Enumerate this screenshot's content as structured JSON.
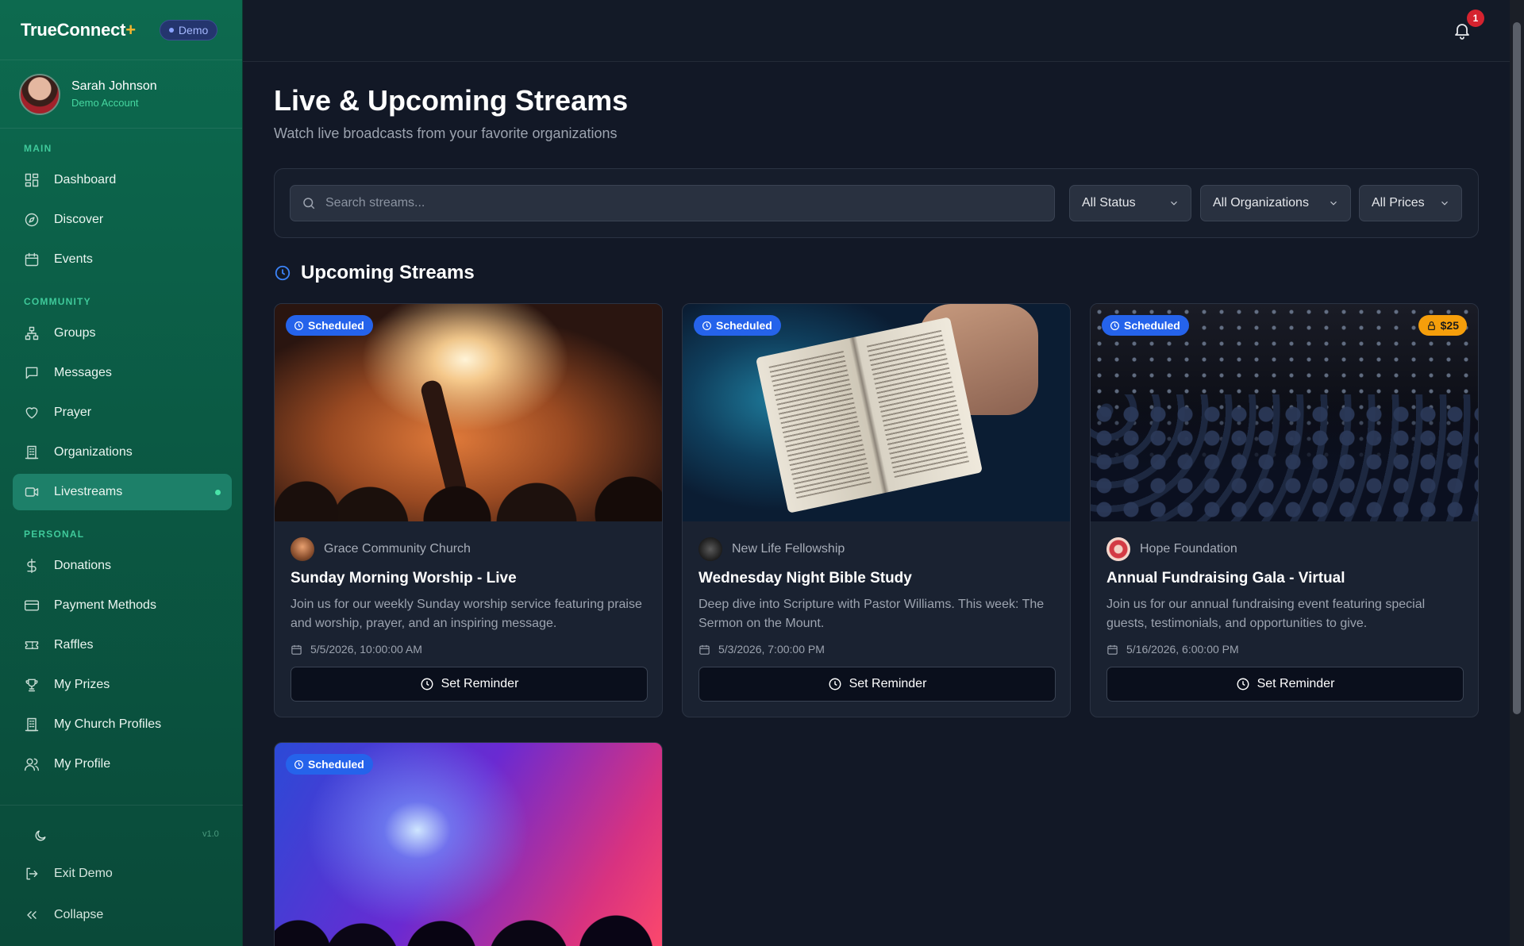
{
  "app": {
    "name": "TrueConnect",
    "plus": "+",
    "mode_badge": "Demo",
    "version": "v1.0"
  },
  "user": {
    "name": "Sarah Johnson",
    "subtitle": "Demo Account"
  },
  "sidebar": {
    "sections": [
      {
        "label": "MAIN",
        "items": [
          {
            "label": "Dashboard",
            "icon": "dashboard-icon"
          },
          {
            "label": "Discover",
            "icon": "compass-icon"
          },
          {
            "label": "Events",
            "icon": "calendar-icon"
          }
        ]
      },
      {
        "label": "COMMUNITY",
        "items": [
          {
            "label": "Groups",
            "icon": "network-icon"
          },
          {
            "label": "Messages",
            "icon": "message-icon"
          },
          {
            "label": "Prayer",
            "icon": "heart-icon"
          },
          {
            "label": "Organizations",
            "icon": "building-icon"
          },
          {
            "label": "Livestreams",
            "icon": "video-icon",
            "active": true
          }
        ]
      },
      {
        "label": "PERSONAL",
        "items": [
          {
            "label": "Donations",
            "icon": "dollar-icon"
          },
          {
            "label": "Payment Methods",
            "icon": "credit-card-icon"
          },
          {
            "label": "Raffles",
            "icon": "ticket-icon"
          },
          {
            "label": "My Prizes",
            "icon": "trophy-icon"
          },
          {
            "label": "My Church Profiles",
            "icon": "building-icon"
          },
          {
            "label": "My Profile",
            "icon": "users-icon"
          }
        ]
      }
    ],
    "footer": {
      "exit_label": "Exit Demo",
      "collapse_label": "Collapse"
    }
  },
  "topbar": {
    "notification_count": "1"
  },
  "page": {
    "title": "Live & Upcoming Streams",
    "subtitle": "Watch live broadcasts from your favorite organizations"
  },
  "filters": {
    "search_placeholder": "Search streams...",
    "status": "All Status",
    "organization": "All Organizations",
    "price": "All Prices"
  },
  "upcoming": {
    "heading": "Upcoming Streams",
    "reminder_label": "Set Reminder",
    "streams": [
      {
        "status": "Scheduled",
        "org": "Grace Community Church",
        "title": "Sunday Morning Worship - Live",
        "description": "Join us for our weekly Sunday worship service featuring praise and worship, prayer, and an inspiring message.",
        "datetime": "5/5/2026, 10:00:00 AM"
      },
      {
        "status": "Scheduled",
        "org": "New Life Fellowship",
        "title": "Wednesday Night Bible Study",
        "description": "Deep dive into Scripture with Pastor Williams. This week: The Sermon on the Mount.",
        "datetime": "5/3/2026, 7:00:00 PM"
      },
      {
        "status": "Scheduled",
        "price": "$25",
        "org": "Hope Foundation",
        "title": "Annual Fundraising Gala - Virtual",
        "description": "Join us for our annual fundraising event featuring special guests, testimonials, and opportunities to give.",
        "datetime": "5/16/2026, 6:00:00 PM"
      },
      {
        "status": "Scheduled"
      }
    ]
  }
}
